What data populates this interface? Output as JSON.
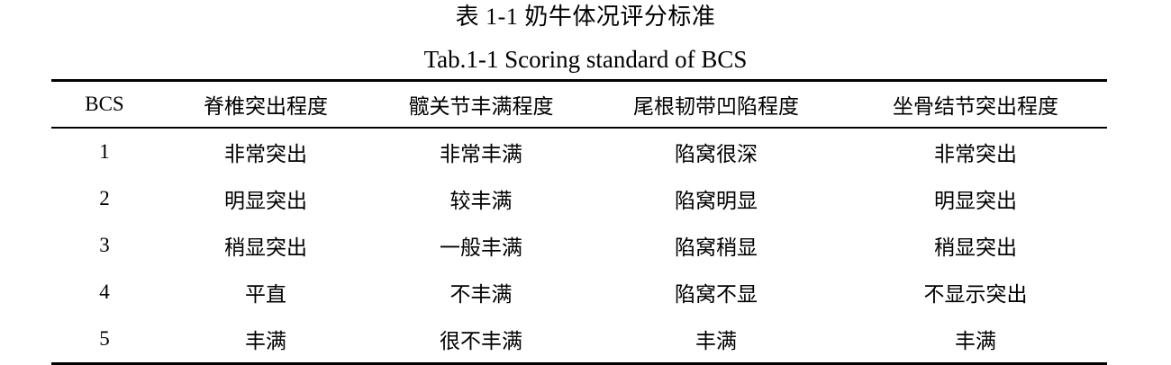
{
  "caption": {
    "cn": "表 1-1  奶牛体况评分标准",
    "en": "Tab.1-1 Scoring standard of BCS"
  },
  "table": {
    "headers": [
      "BCS",
      "脊椎突出程度",
      "髋关节丰满程度",
      "尾根韧带凹陷程度",
      "坐骨结节突出程度"
    ],
    "rows": [
      [
        "1",
        "非常突出",
        "非常丰满",
        "陷窝很深",
        "非常突出"
      ],
      [
        "2",
        "明显突出",
        "较丰满",
        "陷窝明显",
        "明显突出"
      ],
      [
        "3",
        "稍显突出",
        "一般丰满",
        "陷窝稍显",
        "稍显突出"
      ],
      [
        "4",
        "平直",
        "不丰满",
        "陷窝不显",
        "不显示突出"
      ],
      [
        "5",
        "丰满",
        "很不丰满",
        "丰满",
        "丰满"
      ]
    ]
  }
}
